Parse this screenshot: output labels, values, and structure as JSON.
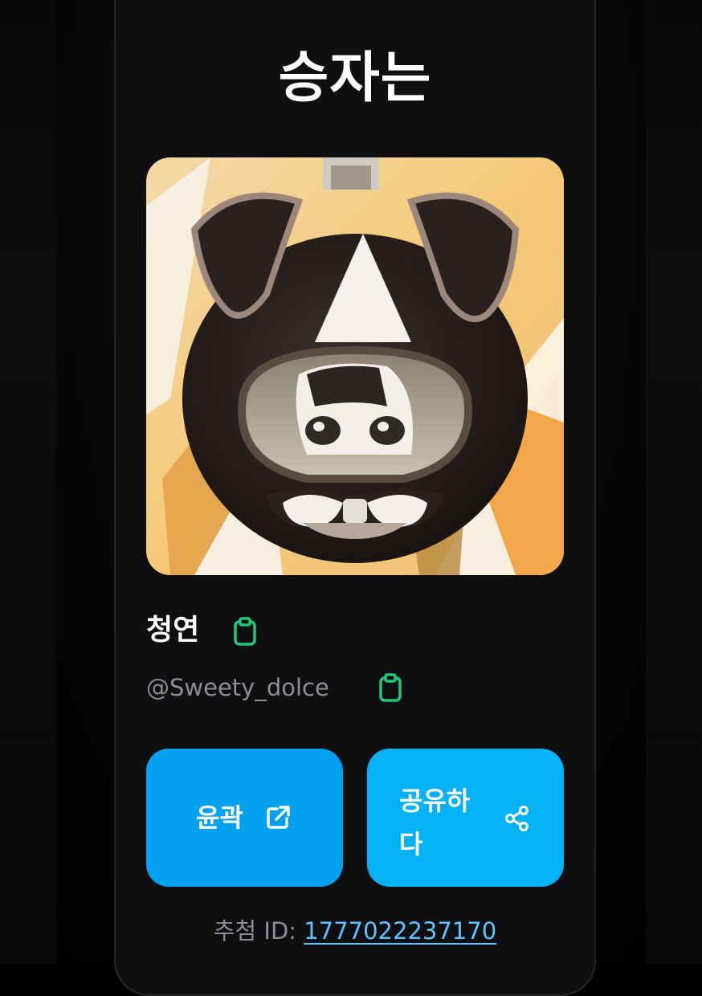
{
  "title": "승자는",
  "winner": {
    "name": "청연",
    "handle": "@Sweety_dolce",
    "photo_icon": "winner-avatar-photo",
    "copy_icon": "clipboard-icon"
  },
  "buttons": {
    "outline_label": "윤곽",
    "outline_icon": "external-link-icon",
    "share_label": "공유하다",
    "share_icon": "share-icon"
  },
  "recommend": {
    "label": "추첨 ID: ",
    "id": "1777022237170"
  },
  "colors": {
    "background": "#000000",
    "card": "#0f0f11",
    "accent": "#04a1f0",
    "accent_alt": "#05b2f7",
    "copy_green": "#22c77a",
    "link": "#5ec3ff",
    "muted_text": "#8d8d93"
  }
}
